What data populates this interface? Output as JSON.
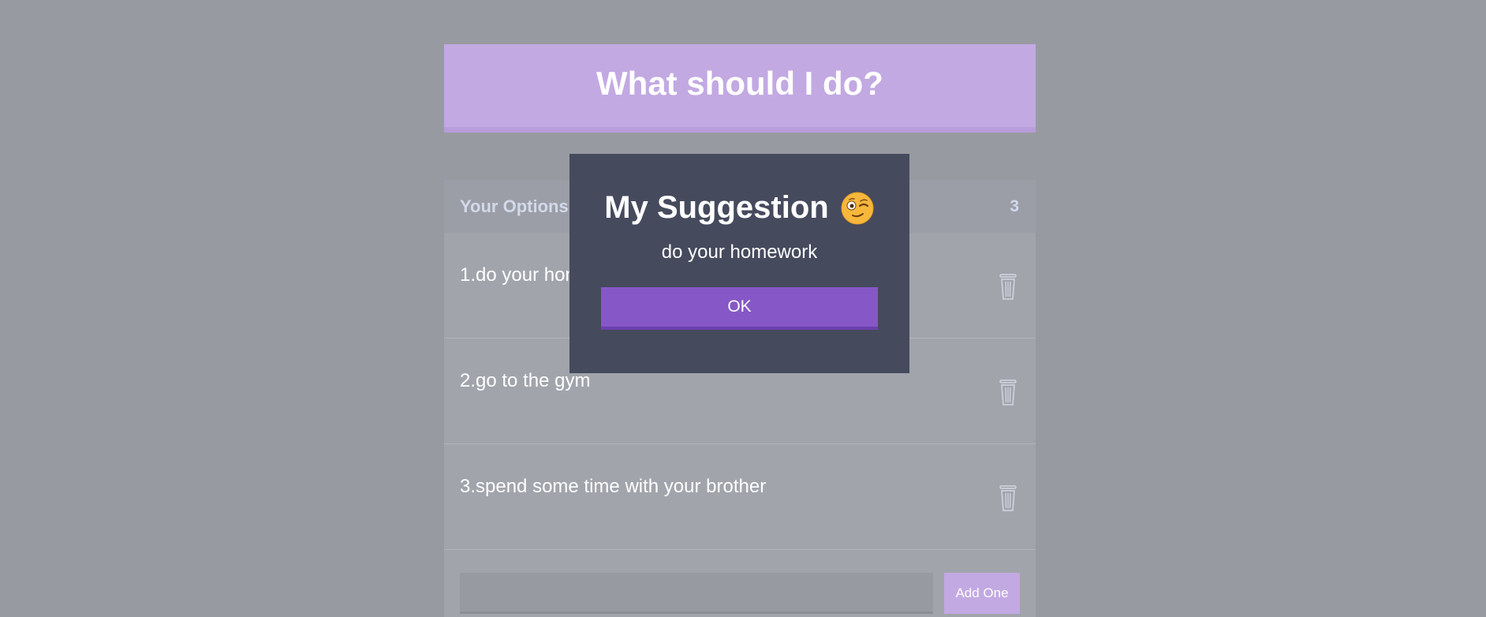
{
  "header": {
    "title": "What should I do?"
  },
  "widget": {
    "title": "Your Options",
    "count": "3",
    "options": [
      {
        "label": "1.do your homework"
      },
      {
        "label": "2.go to the gym"
      },
      {
        "label": "3.spend some time with your brother"
      }
    ],
    "input": {
      "value": "",
      "placeholder": ""
    },
    "add_label": "Add One"
  },
  "modal": {
    "title": "My Suggestion",
    "emoji": "winking-face-emoji",
    "suggestion": "do your homework",
    "ok_label": "OK"
  },
  "colors": {
    "background": "#989aa1",
    "header": "#c2a9e2",
    "modal": "#464a5d",
    "ok_button": "#8657c6"
  }
}
